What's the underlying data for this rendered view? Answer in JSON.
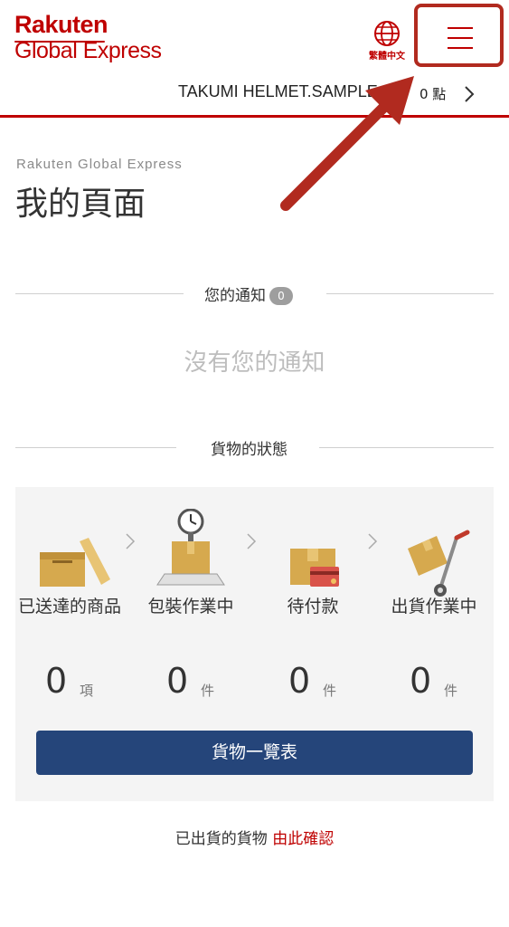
{
  "header": {
    "logo_top": "Rakuten",
    "logo_bottom": "Global Express",
    "language_label": "繁體中文",
    "user_name": "TAKUMI HELMET.SAMPLE",
    "points": "0 點"
  },
  "page": {
    "subtitle": "Rakuten Global Express",
    "title": "我的頁面"
  },
  "notifications": {
    "heading": "您的通知",
    "count": "0",
    "empty_text": "沒有您的通知"
  },
  "shipment_status": {
    "heading": "貨物的狀態",
    "stages": [
      {
        "label": "已送達的商品",
        "count": "0",
        "unit": "項",
        "icon": "box-open-icon"
      },
      {
        "label": "包裝作業中",
        "count": "0",
        "unit": "件",
        "icon": "package-scale-icon"
      },
      {
        "label": "待付款",
        "count": "0",
        "unit": "件",
        "icon": "package-card-icon"
      },
      {
        "label": "出貨作業中",
        "count": "0",
        "unit": "件",
        "icon": "hand-truck-icon"
      }
    ],
    "list_button": "貨物一覽表"
  },
  "footer": {
    "text": "已出貨的貨物",
    "link": "由此確認"
  },
  "colors": {
    "brand_red": "#bf0000",
    "button_navy": "#25457a",
    "highlight_box": "#b12a1f"
  }
}
